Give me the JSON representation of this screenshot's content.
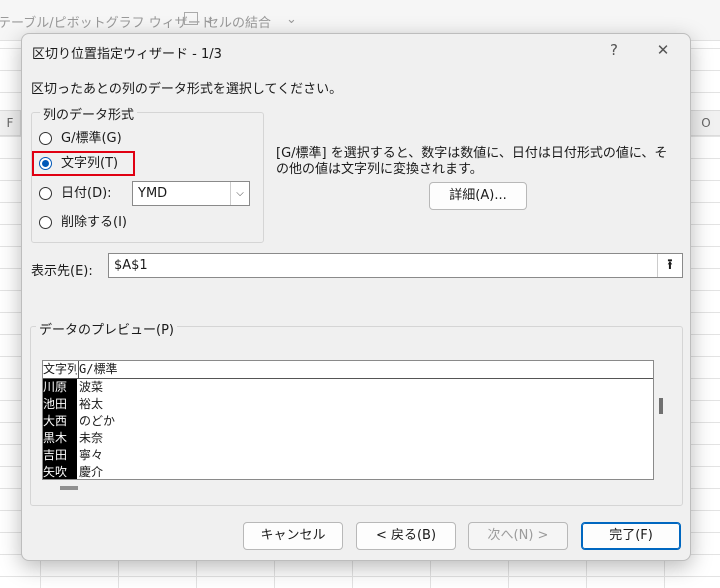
{
  "ribbon": {
    "item1": "テーブル/ピボットグラフ ウィザード",
    "merge_icon": "merge-cells-icon",
    "item2": "セルの結合",
    "more": "⌄"
  },
  "sheet": {
    "col_left": "F",
    "col_right": "O"
  },
  "dialog": {
    "title": "区切り位置指定ウィザード - 1/3",
    "help": "?",
    "close": "✕",
    "instruction": "区切ったあとの列のデータ形式を選択してください。",
    "format_group": {
      "legend": "列のデータ形式",
      "options": [
        {
          "label": "G/標準(G)",
          "selected": false
        },
        {
          "label": "文字列(T)",
          "selected": true
        },
        {
          "label": "日付(D):",
          "selected": false
        },
        {
          "label": "削除する(I)",
          "selected": false
        }
      ],
      "date_value": "YMD"
    },
    "description": "[G/標準] を選択すると、数字は数値に、日付は日付形式の値に、その他の値は文字列に変換されます。",
    "detail_button": "詳細(A)...",
    "destination_label": "表示先(E):",
    "destination_value": "$A$1",
    "preview": {
      "legend": "データのプレビュー(P)",
      "headers": [
        "文字列",
        "G/標準"
      ],
      "rows": [
        [
          "川原",
          "波菜"
        ],
        [
          "池田",
          "裕太"
        ],
        [
          "大西",
          "のどか"
        ],
        [
          "黒木",
          "未奈"
        ],
        [
          "吉田",
          "寧々"
        ],
        [
          "矢吹",
          "慶介"
        ]
      ]
    },
    "buttons": {
      "cancel": "キャンセル",
      "back": "< 戻る(B)",
      "next": "次へ(N) >",
      "finish": "完了(F)"
    }
  },
  "colors": {
    "highlight": "#e00012",
    "accent": "#0067c0"
  }
}
